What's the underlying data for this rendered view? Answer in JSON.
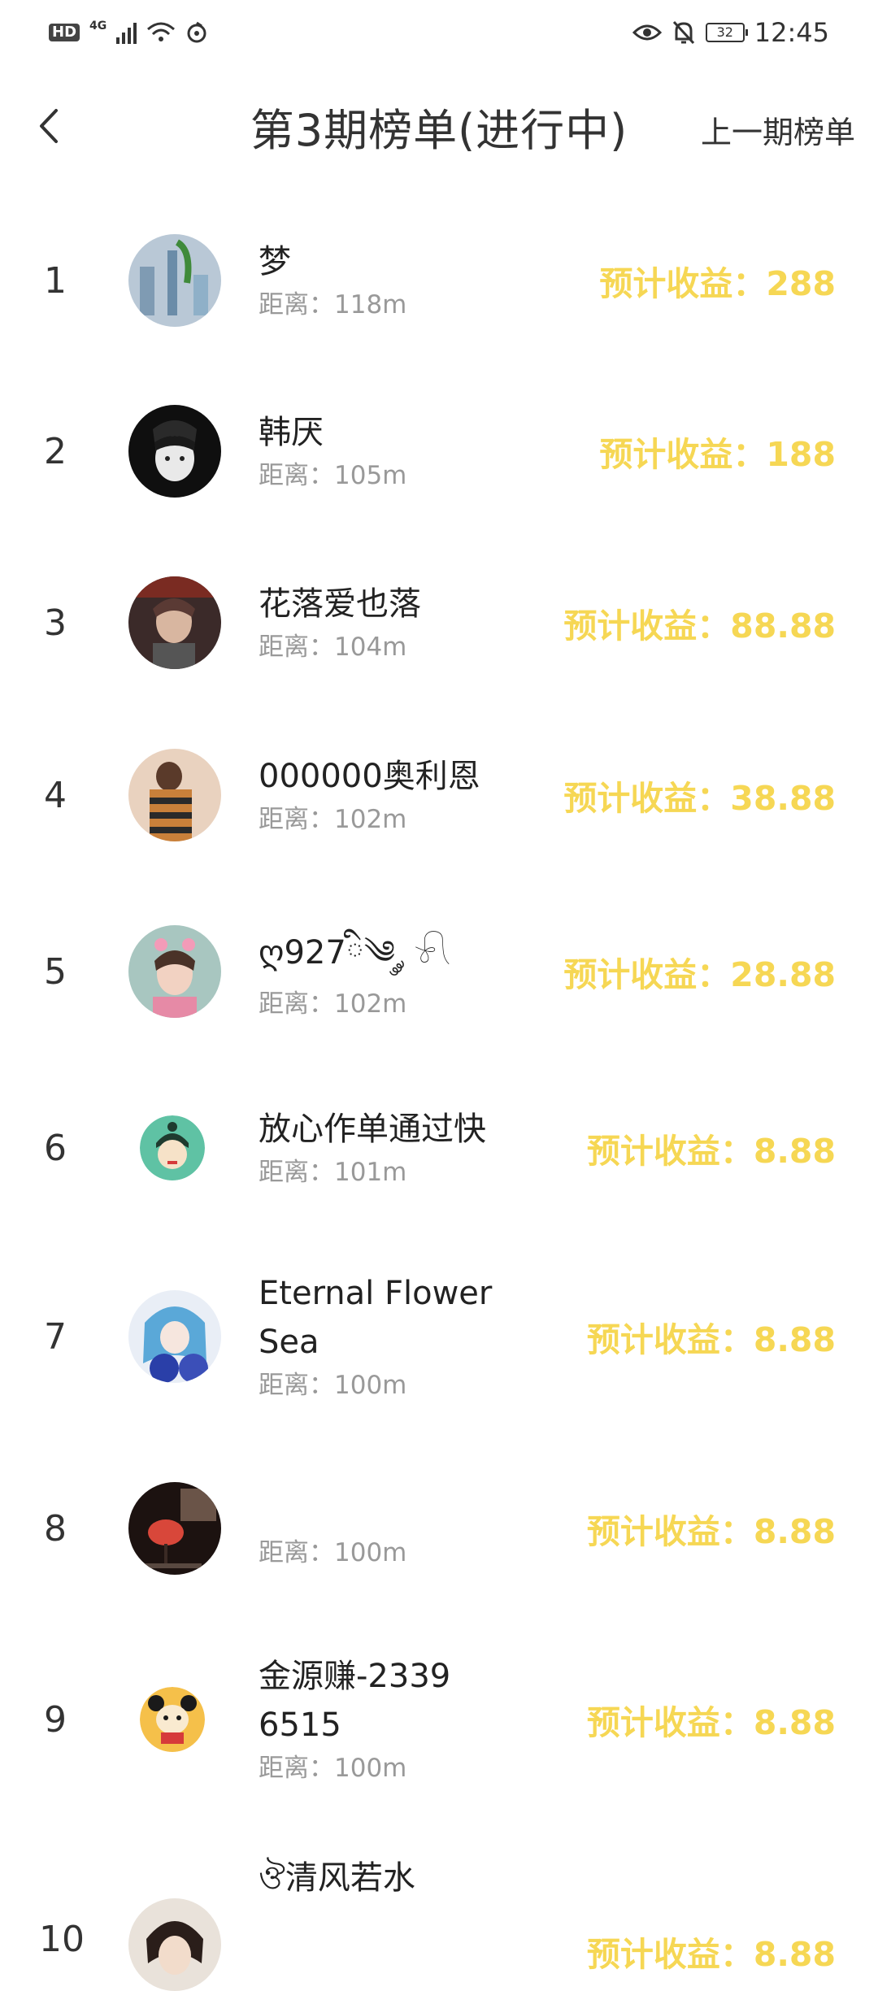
{
  "status_bar": {
    "hd": "HD",
    "network": "4G",
    "battery": "32",
    "time": "12:45"
  },
  "header": {
    "title": "第3期榜单(进行中)",
    "prev_link": "上一期榜单",
    "back_icon": "chevron-left-icon"
  },
  "rank_list": [
    {
      "rank": "1",
      "name": "梦",
      "distance": "距离：118m",
      "earnings": "预计收益：288",
      "avatar_color": "#8aa6c4"
    },
    {
      "rank": "2",
      "name": "韩厌",
      "distance": "距离：105m",
      "earnings": "预计收益：188",
      "avatar_color": "#1a1a1a"
    },
    {
      "rank": "3",
      "name": "花落爱也落",
      "distance": "距离：104m",
      "earnings": "预计收益：88.88",
      "avatar_color": "#5a3b3a"
    },
    {
      "rank": "4",
      "name": "000000奥利恩",
      "distance": "距离：102m",
      "earnings": "预计收益：38.88",
      "avatar_color": "#c9893a"
    },
    {
      "rank": "5",
      "name": "ღ927ི༄ ༘ 𓍯",
      "distance": "距离：102m",
      "earnings": "预计收益：28.88",
      "avatar_color": "#d9a6a8"
    },
    {
      "rank": "6",
      "name": "放心作单通过快",
      "distance": "距离：101m",
      "earnings": "预计收益：8.88",
      "avatar_color": "#5fc2a4"
    },
    {
      "rank": "7",
      "name": "Eternal Flower Sea",
      "distance": "距离：100m",
      "earnings": "预计收益：8.88",
      "avatar_color": "#5aa8d8"
    },
    {
      "rank": "8",
      "name": "",
      "distance": "距离：100m",
      "earnings": "预计收益：8.88",
      "avatar_color": "#2b1a14"
    },
    {
      "rank": "9",
      "name": "金源赚-23396515",
      "distance": "距离：100m",
      "earnings": "预计收益：8.88",
      "avatar_color": "#f5c04a"
    },
    {
      "rank": "10",
      "name": "ঔ清风若水",
      "distance": "",
      "earnings": "预计收益：8.88",
      "avatar_color": "#3a2e2a"
    }
  ],
  "colors": {
    "earnings": "#f6d754",
    "distance": "#999999"
  }
}
